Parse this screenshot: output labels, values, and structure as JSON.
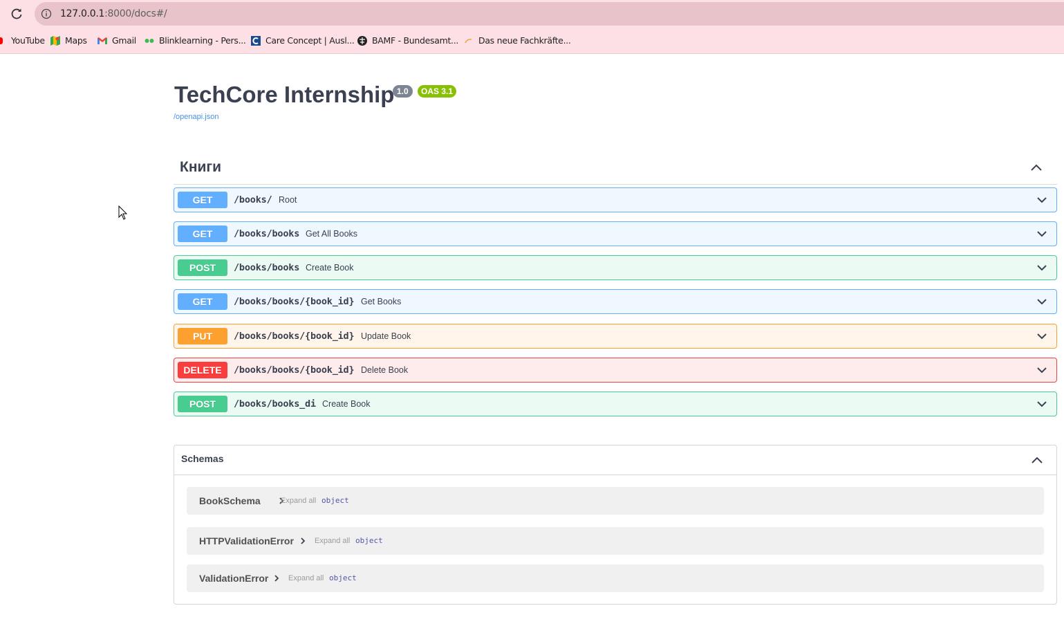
{
  "browser": {
    "url_host": "127.0.0.1",
    "url_path": ":8000/docs#/",
    "bookmarks": [
      {
        "label": "YouTube",
        "icon": "youtube-icon"
      },
      {
        "label": "Maps",
        "icon": "maps-icon"
      },
      {
        "label": "Gmail",
        "icon": "gmail-icon"
      },
      {
        "label": "Blinklearning - Pers...",
        "icon": "blinklearning-icon"
      },
      {
        "label": "Care Concept | Ausl...",
        "icon": "care-concept-icon"
      },
      {
        "label": "BAMF - Bundesamt...",
        "icon": "bamf-icon"
      },
      {
        "label": "Das neue Fachkräfte...",
        "icon": "fachkraefte-icon"
      }
    ]
  },
  "info": {
    "title": "TechCore Internship",
    "version": "1.0",
    "oas": "OAS 3.1",
    "spec_link": "/openapi.json"
  },
  "tag": {
    "name": "Книги"
  },
  "operations": [
    {
      "method": "GET",
      "path": "/books/",
      "summary": "Root"
    },
    {
      "method": "GET",
      "path": "/books/books",
      "summary": "Get All Books"
    },
    {
      "method": "POST",
      "path": "/books/books",
      "summary": "Create Book"
    },
    {
      "method": "GET",
      "path": "/books/books/{book_id}",
      "summary": "Get Books"
    },
    {
      "method": "PUT",
      "path": "/books/books/{book_id}",
      "summary": "Update Book"
    },
    {
      "method": "DELETE",
      "path": "/books/books/{book_id}",
      "summary": "Delete Book"
    },
    {
      "method": "POST",
      "path": "/books/books_di",
      "summary": "Create Book"
    }
  ],
  "schemas": {
    "title": "Schemas",
    "expand_label": "Expand all",
    "models": [
      {
        "name": "BookSchema",
        "type": "object"
      },
      {
        "name": "HTTPValidationError",
        "type": "object"
      },
      {
        "name": "ValidationError",
        "type": "object"
      }
    ]
  },
  "colors": {
    "get": "#61affe",
    "post": "#49cc90",
    "put": "#fca130",
    "delete": "#f93e3e",
    "version_badge": "#7d8492",
    "oas_badge": "#89bf04"
  }
}
